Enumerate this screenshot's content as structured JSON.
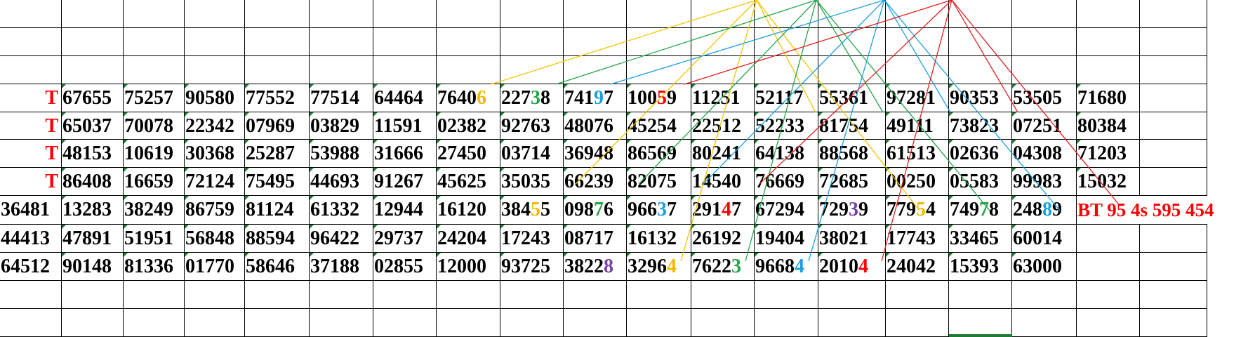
{
  "sheet": {
    "rows": [
      {
        "type": "empty"
      },
      {
        "type": "empty"
      },
      {
        "type": "empty"
      },
      {
        "type": "data",
        "label": "T",
        "values": [
          "67655",
          "75257",
          "90580",
          "77552",
          "77514",
          "64464",
          "76406",
          "22738",
          "74197",
          "10059",
          "11251",
          "52117",
          "55361",
          "97281",
          "90353",
          "53505",
          "71680"
        ]
      },
      {
        "type": "data",
        "label": "T",
        "values": [
          "65037",
          "70078",
          "22342",
          "07969",
          "03829",
          "11591",
          "02382",
          "92763",
          "48076",
          "45254",
          "22512",
          "52233",
          "81754",
          "49111",
          "73823",
          "07251",
          "80384"
        ]
      },
      {
        "type": "data",
        "label": "T",
        "values": [
          "48153",
          "10619",
          "30368",
          "25287",
          "53988",
          "31666",
          "27450",
          "03714",
          "36948",
          "86569",
          "80241",
          "64138",
          "88568",
          "61513",
          "02636",
          "04308",
          "71203"
        ]
      },
      {
        "type": "data",
        "label": "T",
        "values": [
          "86408",
          "16659",
          "72124",
          "75495",
          "44693",
          "91267",
          "45625",
          "35035",
          "66239",
          "82075",
          "14540",
          "76669",
          "72685",
          "00250",
          "05583",
          "99983",
          "15032"
        ]
      },
      {
        "type": "data",
        "label": "36481",
        "values": [
          "13283",
          "38249",
          "86759",
          "81124",
          "61332",
          "12944",
          "16120",
          "38455",
          "09876",
          "96637",
          "29147",
          "67294",
          "72939",
          "77954",
          "74978",
          "24889"
        ],
        "note": "BT 95  4s 595 454"
      },
      {
        "type": "data",
        "label": "44413",
        "values": [
          "47891",
          "51951",
          "56848",
          "88594",
          "96422",
          "29737",
          "24204",
          "17243",
          "08717",
          "16132",
          "26192",
          "19404",
          "38021",
          "17743",
          "33465",
          "60014"
        ]
      },
      {
        "type": "data",
        "label": "64512",
        "values": [
          "90148",
          "81336",
          "01770",
          "58646",
          "37188",
          "02855",
          "12000",
          "93725",
          "38228",
          "32964",
          "76223",
          "96684",
          "20104",
          "24042",
          "15393",
          "63000"
        ]
      },
      {
        "type": "empty"
      },
      {
        "type": "empty"
      }
    ],
    "highlights": [
      {
        "row": 3,
        "col": 7,
        "digit_index": 4,
        "color": "#f5b800"
      },
      {
        "row": 3,
        "col": 8,
        "digit_index": 3,
        "color": "#22a64a"
      },
      {
        "row": 3,
        "col": 9,
        "digit_index": 3,
        "color": "#1a9fe0"
      },
      {
        "row": 3,
        "col": 10,
        "digit_index": 3,
        "color": "#ff0000"
      },
      {
        "row": 7,
        "col": 8,
        "digit_index": 3,
        "color": "#f5b800"
      },
      {
        "row": 7,
        "col": 9,
        "digit_index": 3,
        "color": "#22a64a"
      },
      {
        "row": 7,
        "col": 10,
        "digit_index": 3,
        "color": "#1a9fe0"
      },
      {
        "row": 7,
        "col": 11,
        "digit_index": 3,
        "color": "#ff0000"
      },
      {
        "row": 7,
        "col": 13,
        "digit_index": 3,
        "color": "#7a3fa8"
      },
      {
        "row": 7,
        "col": 14,
        "digit_index": 3,
        "color": "#f5b800"
      },
      {
        "row": 7,
        "col": 15,
        "digit_index": 3,
        "color": "#22a64a"
      },
      {
        "row": 7,
        "col": 16,
        "digit_index": 3,
        "color": "#1a9fe0"
      },
      {
        "row": 9,
        "col": 9,
        "digit_index": 4,
        "color": "#7a3fa8"
      },
      {
        "row": 9,
        "col": 10,
        "digit_index": 4,
        "color": "#f5b800"
      },
      {
        "row": 9,
        "col": 11,
        "digit_index": 4,
        "color": "#22a64a"
      },
      {
        "row": 9,
        "col": 12,
        "digit_index": 4,
        "color": "#1a9fe0"
      },
      {
        "row": 9,
        "col": 13,
        "digit_index": 4,
        "color": "#ff0000"
      }
    ],
    "colors": {
      "label_red": "#ff0000",
      "line_yellow": "#f5c400",
      "line_green": "#22a64a",
      "line_blue": "#1a9fe0",
      "line_red": "#e02020",
      "grid": "#000000",
      "marker_green": "#1e7b34"
    }
  }
}
